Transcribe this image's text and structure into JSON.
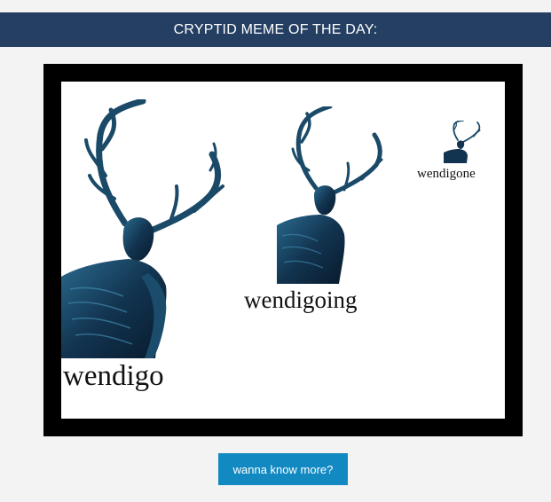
{
  "header": {
    "title": "CRYPTID MEME OF THE DAY:"
  },
  "meme": {
    "captions": {
      "large": "wendigo",
      "medium": "wendigoing",
      "small": "wendigone"
    },
    "figure_color": "#153a57"
  },
  "actions": {
    "more_label": "wanna know more?"
  },
  "colors": {
    "header_bg": "#243f62",
    "page_bg": "#f3f3f4",
    "button_bg": "#1289c1",
    "frame": "#000000"
  }
}
